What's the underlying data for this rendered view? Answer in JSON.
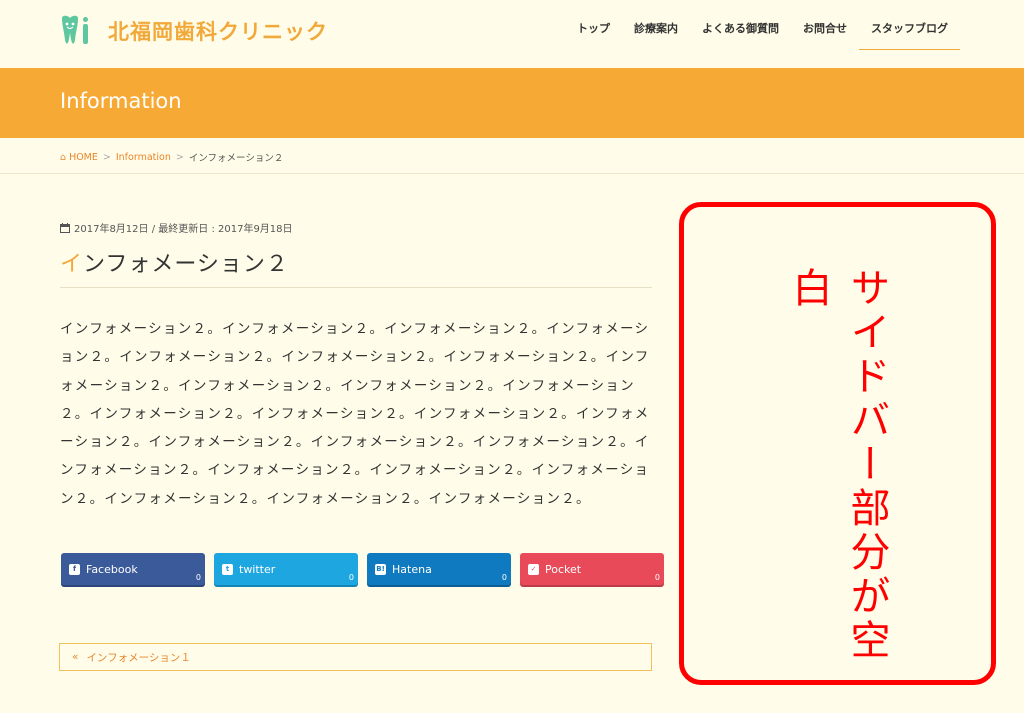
{
  "header": {
    "logo_text": "北福岡歯科クリニック",
    "nav": [
      {
        "label": "トップ"
      },
      {
        "label": "診療案内"
      },
      {
        "label": "よくある御質問"
      },
      {
        "label": "お問合せ"
      },
      {
        "label": "スタッフブログ"
      }
    ],
    "active_nav": "スタッフブログ"
  },
  "page_title": "Information",
  "breadcrumb": {
    "home": "HOME",
    "separator": ">",
    "category": "Information",
    "current": "インフォメーション２"
  },
  "post": {
    "meta": "2017年8月12日 / 最終更新日 : 2017年9月18日",
    "title_first_char": "イ",
    "title_rest": "ンフォメーション２",
    "body": "インフォメーション２。インフォメーション２。インフォメーション２。インフォメーション２。インフォメーション２。インフォメーション２。インフォメーション２。インフォメーション２。インフォメーション２。インフォメーション２。インフォメーション２。インフォメーション２。インフォメーション２。インフォメーション２。インフォメーション２。インフォメーション２。インフォメーション２。インフォメーション２。インフォメーション２。インフォメーション２。インフォメーション２。インフォメーション２。インフォメーション２。インフォメーション２。インフォメーション２。"
  },
  "share": [
    {
      "label": "Facebook",
      "count": "0",
      "icon": "facebook-icon",
      "color": "#3b5a9a"
    },
    {
      "label": "twitter",
      "count": "0",
      "icon": "twitter-icon",
      "color": "#1ea6e0"
    },
    {
      "label": "Hatena",
      "count": "0",
      "icon": "hatena-icon",
      "color": "#0f7abf"
    },
    {
      "label": "Pocket",
      "count": "0",
      "icon": "pocket-icon",
      "color": "#e84a5a"
    }
  ],
  "pager": {
    "prev_arrow": "«",
    "prev_label": "インフォメーション１"
  },
  "annotation": {
    "text": "サイドバー部分が空白",
    "color": "#ff0000"
  },
  "colors": {
    "accent": "#f7a935",
    "background": "#fffde9",
    "logo_green": "#5fc7a0"
  }
}
